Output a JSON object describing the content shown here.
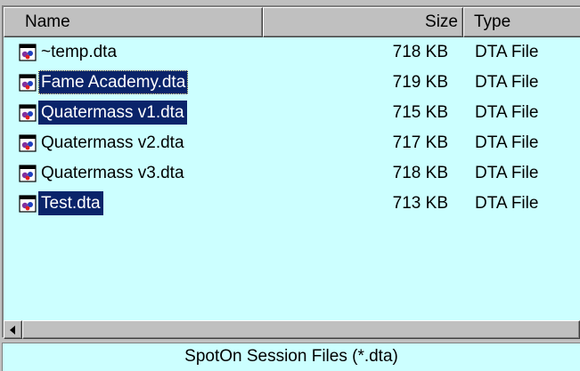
{
  "columns": {
    "name": "Name",
    "size": "Size",
    "type": "Type"
  },
  "files": [
    {
      "name": "~temp.dta",
      "size": "718 KB",
      "type": "DTA File",
      "selected": false,
      "focused": false
    },
    {
      "name": "Fame Academy.dta",
      "size": "719 KB",
      "type": "DTA File",
      "selected": true,
      "focused": true
    },
    {
      "name": "Quatermass v1.dta",
      "size": "715 KB",
      "type": "DTA File",
      "selected": true,
      "focused": false
    },
    {
      "name": "Quatermass v2.dta",
      "size": "717 KB",
      "type": "DTA File",
      "selected": false,
      "focused": false
    },
    {
      "name": "Quatermass v3.dta",
      "size": "718 KB",
      "type": "DTA File",
      "selected": false,
      "focused": false
    },
    {
      "name": "Test.dta",
      "size": "713 KB",
      "type": "DTA File",
      "selected": true,
      "focused": false
    }
  ],
  "status": {
    "filter_text": "SpotOn Session Files (*.dta)"
  },
  "icons": {
    "file_icon": "dta-file-icon",
    "scroll_left": "arrow-left-icon"
  },
  "colors": {
    "list_bg": "#ccffff",
    "selection_bg": "#0a246a",
    "selection_text": "#ffffff"
  }
}
